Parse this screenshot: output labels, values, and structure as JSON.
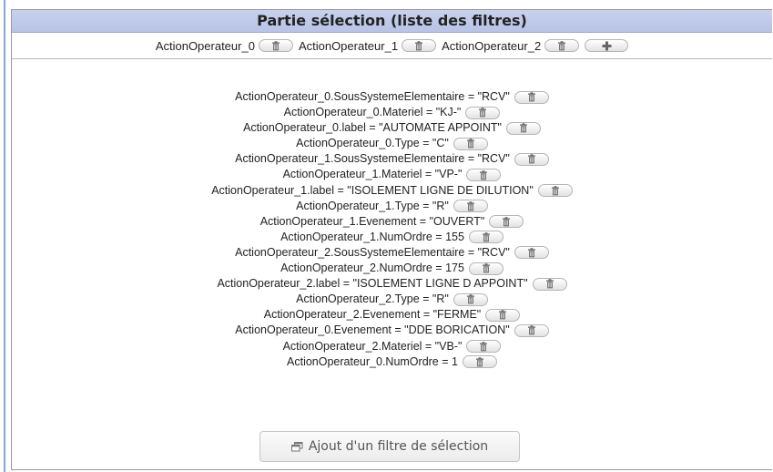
{
  "panel": {
    "title": "Partie sélection (liste des filtres)"
  },
  "operators": [
    {
      "label": "ActionOperateur_0",
      "delete_icon": "trash-icon"
    },
    {
      "label": "ActionOperateur_1",
      "delete_icon": "trash-icon"
    },
    {
      "label": "ActionOperateur_2",
      "delete_icon": "trash-icon"
    }
  ],
  "add_operator_icon": "plus-icon",
  "filters": [
    "ActionOperateur_0.SousSystemeElementaire = \"RCV\"",
    "ActionOperateur_0.Materiel = \"KJ-\"",
    "ActionOperateur_0.label = \"AUTOMATE APPOINT\"",
    "ActionOperateur_0.Type = \"C\"",
    "ActionOperateur_1.SousSystemeElementaire = \"RCV\"",
    "ActionOperateur_1.Materiel = \"VP-\"",
    "ActionOperateur_1.label = \"ISOLEMENT LIGNE DE DILUTION\"",
    "ActionOperateur_1.Type = \"R\"",
    "ActionOperateur_1.Evenement = \"OUVERT\"",
    "ActionOperateur_1.NumOrdre = 155",
    "ActionOperateur_2.SousSystemeElementaire = \"RCV\"",
    "ActionOperateur_2.NumOrdre = 175",
    "ActionOperateur_2.label = \"ISOLEMENT LIGNE D APPOINT\"",
    "ActionOperateur_2.Type = \"R\"",
    "ActionOperateur_2.Evenement = \"FERME\"",
    "ActionOperateur_0.Evenement = \"DDE BORICATION\"",
    "ActionOperateur_2.Materiel = \"VB-\"",
    "ActionOperateur_0.NumOrdre = 1"
  ],
  "add_filter": {
    "label": "Ajout d'un filtre de sélection",
    "icon": "new-window-icon"
  },
  "colors": {
    "header_bg": "#c1cbe9",
    "border": "#9a9a9a",
    "accent_left": "#8aa6c8"
  }
}
